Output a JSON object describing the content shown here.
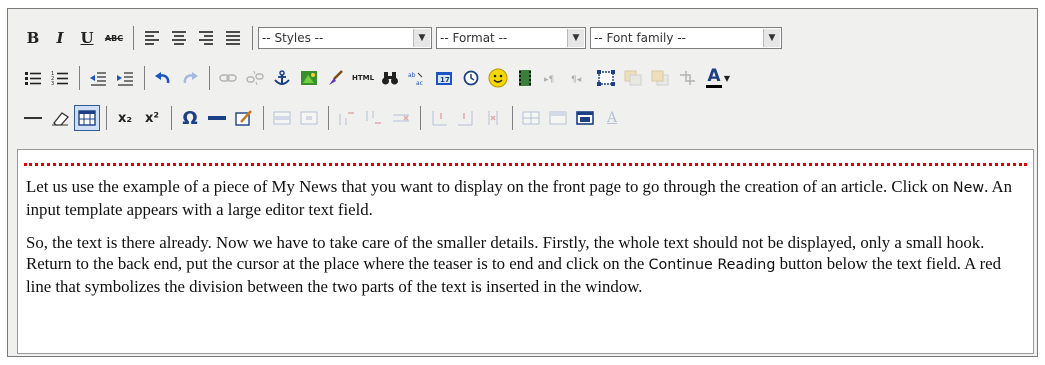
{
  "toolbar": {
    "styles_label": "-- Styles --",
    "format_label": "-- Format --",
    "font_family_label": "-- Font family --",
    "bold_label": "B",
    "italic_label": "I",
    "underline_label": "U",
    "strikethrough_label": "ABC",
    "html_label": "HTML",
    "subscript_label": "x₂",
    "superscript_label": "x²",
    "omega_label": "Ω",
    "font_color_label": "A",
    "style_label": "A"
  },
  "editor": {
    "p1_a": "Let us use the example of a piece of My News that you want to display on the front page to go through the creation of an article. Click on ",
    "p1_ui": "New",
    "p1_b": ". An input template appears with a large editor text field.",
    "p2_a": "So, the text is there already. Now we have to take care of the smaller details. Firstly, the whole text should not be displayed, only a small hook. Return to the back end, put the cursor at the place where the teaser is to end and click on the ",
    "p2_ui": "Continue Reading",
    "p2_b": " button below the text field. A red line that symbolizes the division between the two parts of the text is inserted in the window."
  },
  "icons": {
    "align_left": "align-left-icon",
    "align_center": "align-center-icon",
    "align_right": "align-right-icon",
    "align_justify": "align-justify-icon",
    "undo": "undo-icon",
    "redo": "redo-icon",
    "link": "link-icon",
    "unlink": "unlink-icon",
    "anchor": "anchor-icon",
    "image": "image-icon",
    "cleanup": "cleanup-brush-icon",
    "search": "search-binoculars-icon",
    "emotions": "smiley-icon",
    "media": "media-film-icon"
  },
  "colors": {
    "undo_blue": "#1c54c6",
    "page_break_red": "#e00000",
    "active_border": "#315b9b"
  }
}
